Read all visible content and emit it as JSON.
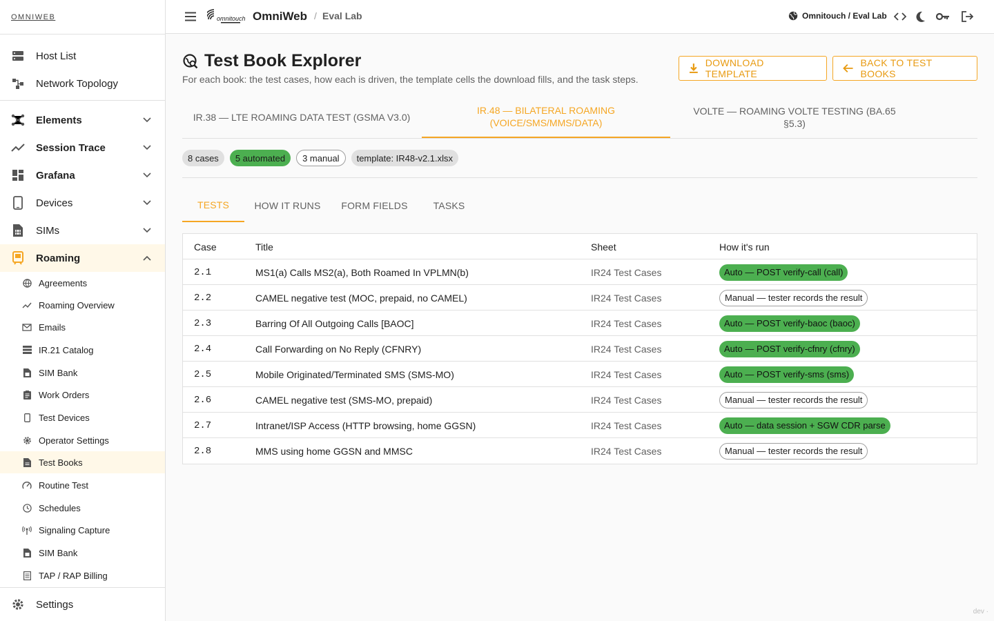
{
  "sidebar": {
    "brand": "OMNIWEB",
    "top_items": [
      {
        "label": "Host List",
        "icon": "server-icon"
      },
      {
        "label": "Network Topology",
        "icon": "topology-icon"
      }
    ],
    "groups": [
      {
        "label": "Elements",
        "icon": "hub-icon",
        "expanded": false
      },
      {
        "label": "Session Trace",
        "icon": "trend-icon",
        "expanded": false
      },
      {
        "label": "Grafana",
        "icon": "dashboard-icon",
        "expanded": false
      },
      {
        "label": "Devices",
        "icon": "phone-icon",
        "expanded": false
      },
      {
        "label": "SIMs",
        "icon": "sim-icon",
        "expanded": false
      },
      {
        "label": "Roaming",
        "icon": "roaming-icon",
        "expanded": true
      }
    ],
    "roaming_items": [
      {
        "label": "Agreements",
        "icon": "globe-icon"
      },
      {
        "label": "Roaming Overview",
        "icon": "trend-icon"
      },
      {
        "label": "Emails",
        "icon": "mail-icon"
      },
      {
        "label": "IR.21 Catalog",
        "icon": "list-icon"
      },
      {
        "label": "SIM Bank",
        "icon": "sim-icon"
      },
      {
        "label": "Work Orders",
        "icon": "clipboard-icon"
      },
      {
        "label": "Test Devices",
        "icon": "phone-icon"
      },
      {
        "label": "Operator Settings",
        "icon": "gear-icon"
      },
      {
        "label": "Test Books",
        "icon": "document-icon"
      },
      {
        "label": "Routine Test",
        "icon": "speed-icon"
      },
      {
        "label": "Schedules",
        "icon": "clock-icon"
      },
      {
        "label": "Signaling Capture",
        "icon": "antenna-icon"
      },
      {
        "label": "SIM Bank",
        "icon": "sim-icon"
      },
      {
        "label": "TAP / RAP Billing",
        "icon": "receipt-icon"
      }
    ],
    "settings_label": "Settings"
  },
  "header": {
    "app_title": "OmniWeb",
    "crumb_sep": "/",
    "crumb": "Eval Lab",
    "tenant": "Omnitouch / Eval Lab"
  },
  "page": {
    "title": "Test Book Explorer",
    "subtitle": "For each book: the test cases, how each is driven, the template cells the download fills, and the task steps.",
    "download_label": "DOWNLOAD TEMPLATE",
    "back_label": "BACK TO TEST BOOKS"
  },
  "book_tabs": [
    {
      "label": "IR.38 — LTE ROAMING DATA TEST (GSMA V3.0)",
      "active": false
    },
    {
      "label": "IR.48 — BILATERAL ROAMING (VOICE/SMS/MMS/DATA)",
      "active": true
    },
    {
      "label": "VOLTE — ROAMING VOLTE TESTING (BA.65 §5.3)",
      "active": false
    }
  ],
  "chips": {
    "cases": "8 cases",
    "automated": "5 automated",
    "manual": "3 manual",
    "template": "template: IR48-v2.1.xlsx"
  },
  "sub_tabs": [
    {
      "label": "TESTS",
      "active": true
    },
    {
      "label": "HOW IT RUNS",
      "active": false
    },
    {
      "label": "FORM FIELDS",
      "active": false
    },
    {
      "label": "TASKS",
      "active": false
    }
  ],
  "table": {
    "headers": [
      "Case",
      "Title",
      "Sheet",
      "How it's run"
    ],
    "rows": [
      {
        "case": "2.1",
        "title": "MS1(a) Calls MS2(a), Both Roamed In VPLMN(b)",
        "sheet": "IR24 Test Cases",
        "how": "Auto — POST verify-call (call)",
        "mode": "auto"
      },
      {
        "case": "2.2",
        "title": "CAMEL negative test (MOC, prepaid, no CAMEL)",
        "sheet": "IR24 Test Cases",
        "how": "Manual — tester records the result",
        "mode": "manual"
      },
      {
        "case": "2.3",
        "title": "Barring Of All Outgoing Calls [BAOC]",
        "sheet": "IR24 Test Cases",
        "how": "Auto — POST verify-baoc (baoc)",
        "mode": "auto"
      },
      {
        "case": "2.4",
        "title": "Call Forwarding on No Reply (CFNRY)",
        "sheet": "IR24 Test Cases",
        "how": "Auto — POST verify-cfnry (cfnry)",
        "mode": "auto"
      },
      {
        "case": "2.5",
        "title": "Mobile Originated/Terminated SMS (SMS-MO)",
        "sheet": "IR24 Test Cases",
        "how": "Auto — POST verify-sms (sms)",
        "mode": "auto"
      },
      {
        "case": "2.6",
        "title": "CAMEL negative test (SMS-MO, prepaid)",
        "sheet": "IR24 Test Cases",
        "how": "Manual — tester records the result",
        "mode": "manual"
      },
      {
        "case": "2.7",
        "title": "Intranet/ISP Access (HTTP browsing, home GGSN)",
        "sheet": "IR24 Test Cases",
        "how": "Auto — data session + SGW CDR parse",
        "mode": "auto"
      },
      {
        "case": "2.8",
        "title": "MMS using home GGSN and MMSC",
        "sheet": "IR24 Test Cases",
        "how": "Manual — tester records the result",
        "mode": "manual"
      }
    ]
  },
  "footer_tag": "dev ·",
  "colors": {
    "accent": "#f5a623",
    "auto_badge": "#4caf50"
  }
}
